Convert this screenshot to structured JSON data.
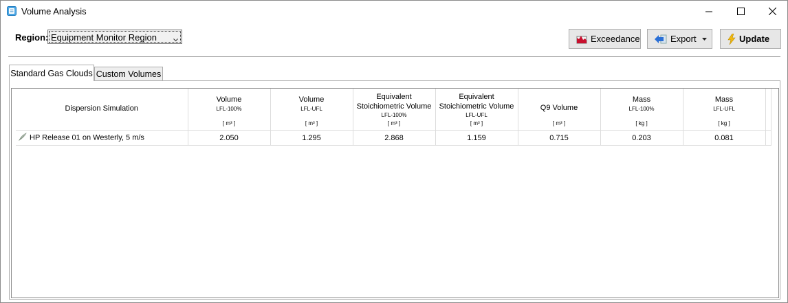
{
  "window": {
    "title": "Volume Analysis"
  },
  "toolbar": {
    "region_label": "Region:",
    "region_value": "Equipment Monitor Region",
    "exceedance_label": "Exceedance",
    "export_label": "Export",
    "update_label": "Update"
  },
  "tabs": [
    {
      "label": "Standard Gas Clouds",
      "active": true
    },
    {
      "label": "Custom Volumes",
      "active": false
    }
  ],
  "table": {
    "columns": [
      {
        "main": "Dispersion Simulation",
        "sub": "",
        "unit": ""
      },
      {
        "main": "Volume",
        "sub": "LFL-100%",
        "unit": "[ m³ ]"
      },
      {
        "main": "Volume",
        "sub": "LFL-UFL",
        "unit": "[ m³ ]"
      },
      {
        "main": "Equivalent",
        "main2": "Stoichiometric Volume",
        "sub": "LFL-100%",
        "unit": "[ m³ ]"
      },
      {
        "main": "Equivalent",
        "main2": "Stoichiometric Volume",
        "sub": "LFL-UFL",
        "unit": "[ m³ ]"
      },
      {
        "main": "Q9 Volume",
        "sub": "",
        "unit": "[ m³ ]"
      },
      {
        "main": "Mass",
        "sub": "LFL-100%",
        "unit": "[ kg ]"
      },
      {
        "main": "Mass",
        "sub": "LFL-UFL",
        "unit": "[ kg ]"
      }
    ],
    "rows": [
      {
        "name": "HP Release 01 on Westerly, 5 m/s",
        "values": [
          "2.050",
          "1.295",
          "2.868",
          "1.159",
          "0.715",
          "0.203",
          "0.081"
        ]
      }
    ]
  },
  "colors": {
    "accent": "#1e90d8",
    "exceedance_icon": "#c8102e",
    "export_icon": "#2a6fd6",
    "update_icon": "#f2b90f"
  },
  "icons": {
    "app": "app-icon",
    "exceedance": "exceedance-icon",
    "export": "export-arrow-icon",
    "update": "lightning-icon",
    "row": "plume-icon"
  }
}
